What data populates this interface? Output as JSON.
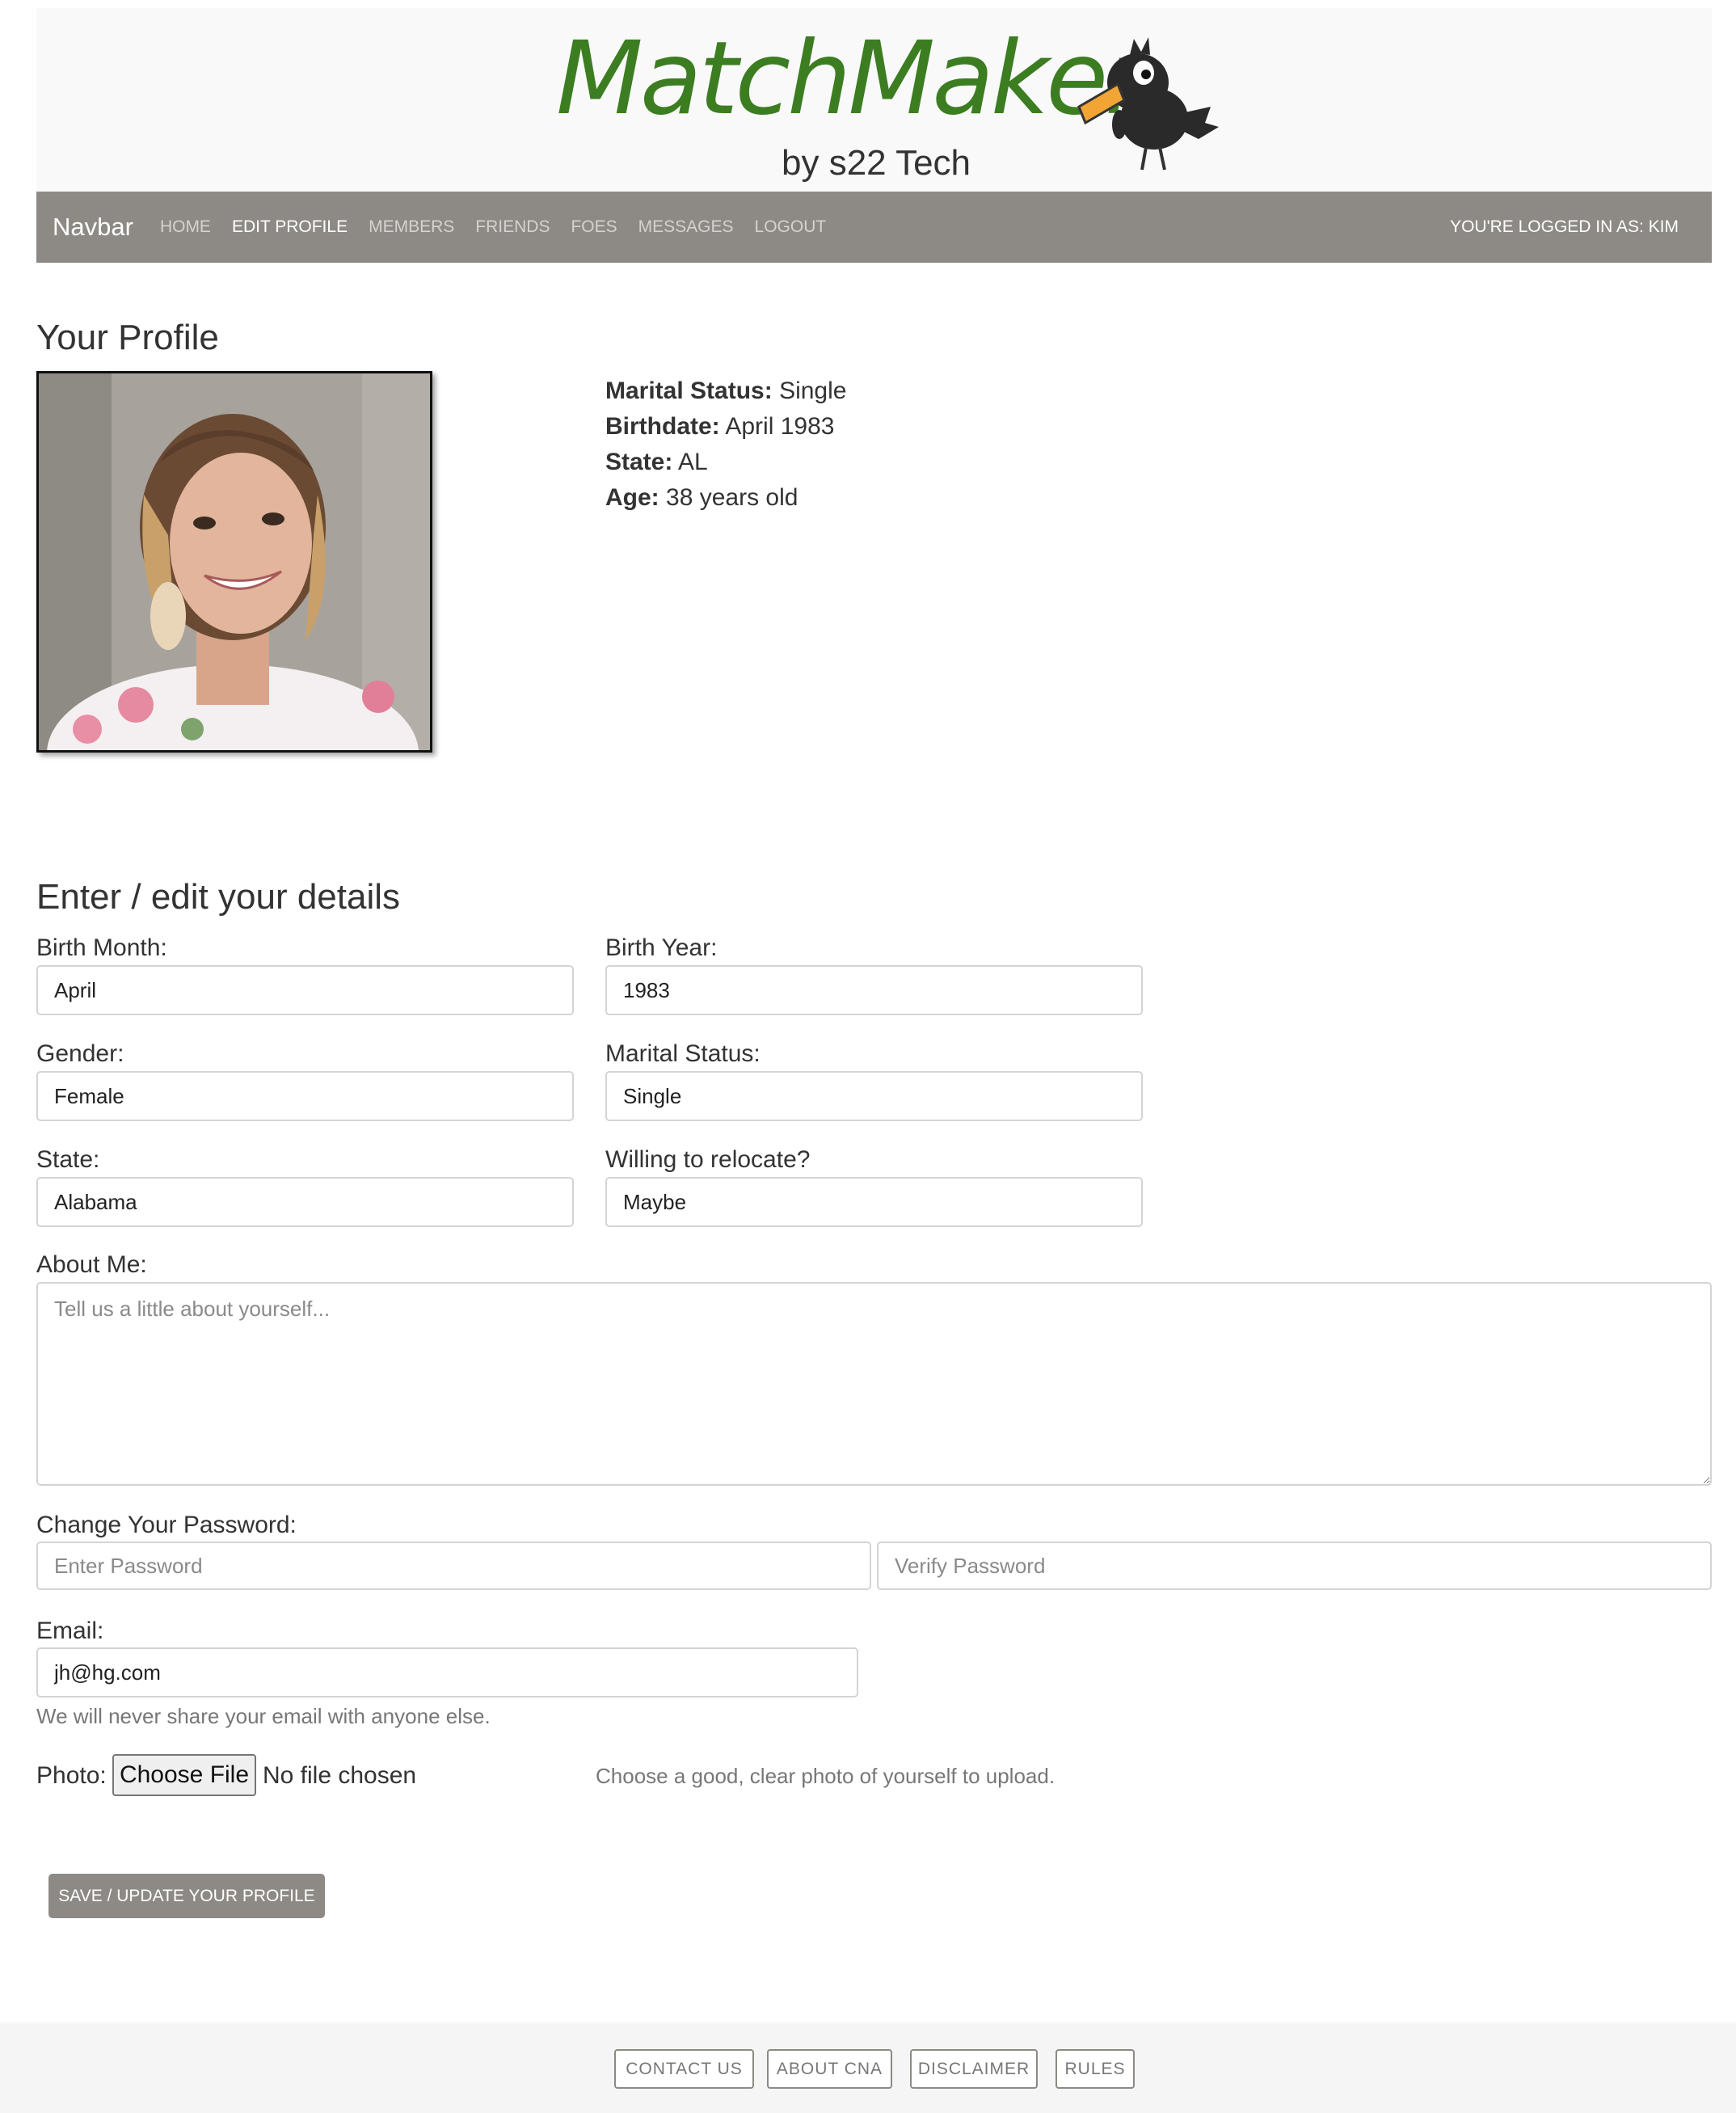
{
  "header": {
    "logo": "MatchMaker",
    "tagline": "by s22 Tech"
  },
  "navbar": {
    "brand": "Navbar",
    "links": [
      "HOME",
      "EDIT PROFILE",
      "MEMBERS",
      "FRIENDS",
      "FOES",
      "MESSAGES",
      "LOGOUT"
    ],
    "active": "EDIT PROFILE",
    "logged_in": "YOU'RE LOGGED IN AS: KIM"
  },
  "profile": {
    "heading": "Your Profile",
    "marital_label": "Marital Status:",
    "marital_value": "Single",
    "birthdate_label": "Birthdate:",
    "birthdate_value": "April 1983",
    "state_label": "State:",
    "state_value": "AL",
    "age_label": "Age:",
    "age_value": "38 years old"
  },
  "form": {
    "heading": "Enter / edit your details",
    "birth_month_label": "Birth Month:",
    "birth_month_value": "April",
    "birth_year_label": "Birth Year:",
    "birth_year_value": "1983",
    "gender_label": "Gender:",
    "gender_value": "Female",
    "marital_label": "Marital Status:",
    "marital_value": "Single",
    "state_label": "State:",
    "state_value": "Alabama",
    "relocate_label": "Willing to relocate?",
    "relocate_value": "Maybe",
    "about_label": "About Me:",
    "about_placeholder": "Tell us a little about yourself...",
    "password_label": "Change Your Password:",
    "password_placeholder": "Enter Password",
    "verify_placeholder": "Verify Password",
    "email_label": "Email:",
    "email_value": "jh@hg.com",
    "email_help": "We will never share your email with anyone else.",
    "photo_label": "Photo:",
    "choose_file": "Choose File",
    "no_file": "No file chosen",
    "photo_help": "Choose a good, clear photo of yourself to upload.",
    "save_label": "SAVE / UPDATE YOUR PROFILE"
  },
  "footer": {
    "links": [
      "CONTACT US",
      "ABOUT CNA",
      "DISCLAIMER",
      "RULES"
    ]
  },
  "icons": {
    "logo_mascot": "crow-icon"
  },
  "colors": {
    "logo_green": "#3c7d22",
    "navbar_bg": "#8d8a85"
  }
}
